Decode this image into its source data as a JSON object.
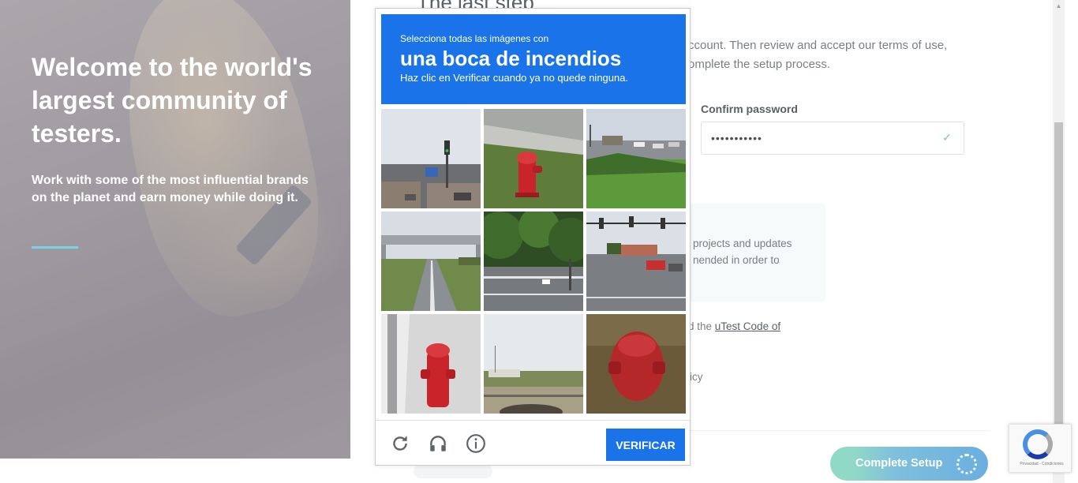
{
  "hero": {
    "title": "Welcome to the world's largest community of testers.",
    "subtitle": "Work with some of the most influential brands on the planet and earn money while doing it."
  },
  "form": {
    "step_title": "The last step",
    "intro": "ccount. Then review and accept our terms of use, omplete the setup process.",
    "confirm_password_label": "Confirm password",
    "confirm_password_value": "•••••••••••",
    "info_text": "projects and updates nended in order to",
    "code_prefix": "d the ",
    "code_link": "uTest Code of",
    "policy_fragment": "icy",
    "complete_button": "Complete Setup"
  },
  "captcha": {
    "instruction": "Selecciona todas las imágenes con",
    "target": "una boca de incendios",
    "hint": "Haz clic en Verificar cuando ya no quede ninguna.",
    "verify_button": "VERIFICAR",
    "reload_icon": "reload-icon",
    "audio_icon": "headphones-icon",
    "info_icon": "info-icon",
    "tiles": [
      {
        "scene": "street-traffic-light"
      },
      {
        "scene": "hydrant-grass"
      },
      {
        "scene": "parking-lot-grass"
      },
      {
        "scene": "highway-overpass"
      },
      {
        "scene": "trees-intersection"
      },
      {
        "scene": "intersection-traffic-lights"
      },
      {
        "scene": "hydrant-wall"
      },
      {
        "scene": "field-road"
      },
      {
        "scene": "hydrant-closeup"
      }
    ]
  },
  "recaptcha_badge": {
    "text": "Privacidad - Condiciones"
  },
  "colors": {
    "captcha_blue": "#1a73e8",
    "hero_rule": "#7fd0e6",
    "cta_start": "#8fd9c6",
    "cta_end": "#6aaee0",
    "check_green": "#76c8a7"
  }
}
